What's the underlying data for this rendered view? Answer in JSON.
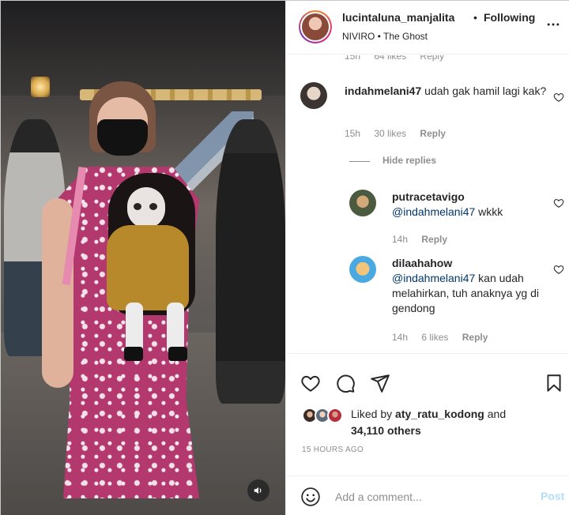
{
  "header": {
    "username": "lucintaluna_manjalita",
    "separator": "•",
    "follow_label": "Following",
    "audio_line": "NIVIRO • The Ghost",
    "more_icon": "more-horizontal-icon"
  },
  "peek_meta": {
    "time": "15h",
    "likes": "64 likes",
    "reply": "Reply"
  },
  "comments": [
    {
      "user": "indahmelani47",
      "text": "udah gak hamil lagi kak?",
      "time": "15h",
      "likes": "30 likes",
      "reply": "Reply"
    }
  ],
  "hide_replies_label": "Hide replies",
  "replies": [
    {
      "user": "putracetavigo",
      "mention": "@indahmelani47",
      "text": " wkkk",
      "time": "14h",
      "reply": "Reply"
    },
    {
      "user": "dilaahahow",
      "mention": "@indahmelani47",
      "text": " kan udah melahirkan, tuh anaknya yg di gendong",
      "time": "14h",
      "likes": "6 likes",
      "reply": "Reply"
    }
  ],
  "actions": {
    "like_icon": "heart-icon",
    "comment_icon": "comment-bubble-icon",
    "share_icon": "paper-plane-icon",
    "save_icon": "bookmark-icon"
  },
  "likes": {
    "prefix": "Liked by ",
    "user": "aty_ratu_kodong",
    "middle": " and ",
    "count": "34,110 others"
  },
  "timestamp": "15 hours ago",
  "add_comment": {
    "placeholder": "Add a comment...",
    "post_label": "Post",
    "emoji_icon": "smiley-icon"
  },
  "media": {
    "sound_icon": "speaker-icon"
  },
  "colors": {
    "link": "#00376b",
    "post_disabled": "#b2dffc",
    "muted": "#8e8e8e",
    "text": "#262626"
  }
}
